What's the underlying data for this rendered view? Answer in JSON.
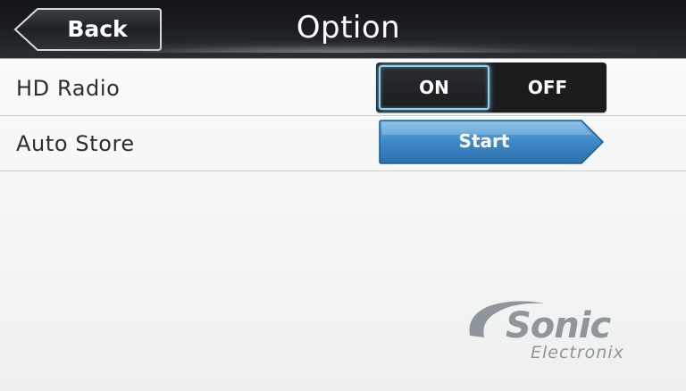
{
  "header": {
    "back_label": "Back",
    "title": "Option"
  },
  "rows": {
    "hd_radio": {
      "label": "HD Radio",
      "on_label": "ON",
      "off_label": "OFF",
      "selected": "ON"
    },
    "auto_store": {
      "label": "Auto Store",
      "button_label": "Start"
    }
  },
  "watermark": {
    "brand": "Sonic",
    "sub": "Electronix"
  },
  "colors": {
    "header_bg": "#1d2023",
    "accent_glow": "#8fd2f4",
    "start_button": "#3a87c6",
    "row_text": "#2c2f31",
    "watermark": "#8e969c"
  },
  "icons": {
    "back": "back-arrow-icon",
    "start": "right-arrow-icon"
  }
}
